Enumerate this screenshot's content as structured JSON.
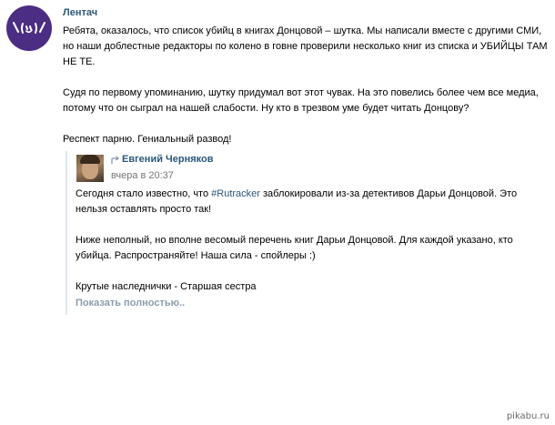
{
  "post": {
    "author": "Лентач",
    "logo_glyph": "\\(ツ)/",
    "paragraphs": [
      "Ребята, оказалось, что список убийц в книгах Донцовой – шутка. Мы написали вместе с другими СМИ, но наши доблестные редакторы по колено в говне проверили несколько книг из списка и УБИЙЦЫ ТАМ НЕ ТЕ.",
      "Судя по первому упоминанию, шутку придумал вот этот чувак. На это повелись более чем все медиа, потому что он сыграл на нашей слабости. Ну кто в трезвом уме будет читать Донцову?",
      "Респект парню. Гениальный развод!"
    ]
  },
  "repost": {
    "author": "Евгений Черняков",
    "time": "вчера в 20:37",
    "para1_before": "Сегодня стало известно, что ",
    "hashtag": "#Rutracker",
    "para1_after": " заблокировали из-за детективов Дарьи Донцовой. Это нельзя оставлять просто так!",
    "para2": "Ниже неполный, но вполне весомый перечень книг Дарьи Донцовой. Для каждой указано, кто убийца. Распространяйте! Наша сила - спойлеры :)",
    "para3": "Крутые наследнички - Старшая сестра",
    "show_more": "Показать полностью.."
  },
  "watermark": "pikabu.ru",
  "colors": {
    "link": "#2b587a",
    "muted": "#777777",
    "show_more": "#8c9cae",
    "avatar_bg": "#4b2e83",
    "quote_border": "#dfe5eb"
  }
}
